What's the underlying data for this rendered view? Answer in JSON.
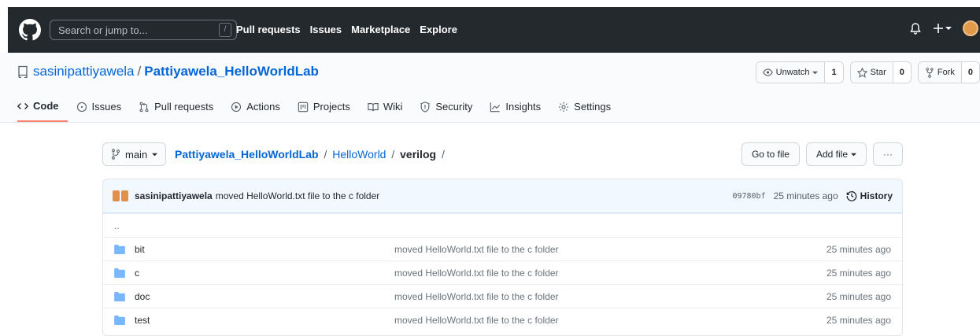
{
  "header": {
    "search_placeholder": "Search or jump to...",
    "search_key": "/",
    "nav": [
      "Pull requests",
      "Issues",
      "Marketplace",
      "Explore"
    ]
  },
  "repo": {
    "owner": "sasinipattiyawela",
    "separator": "/",
    "name": "Pattiyawela_HelloWorldLab",
    "watch_label": "Unwatch",
    "watch_count": "1",
    "star_label": "Star",
    "star_count": "0",
    "fork_label": "Fork",
    "fork_count": "0"
  },
  "tabs": [
    {
      "label": "Code",
      "icon": "code-icon",
      "selected": true
    },
    {
      "label": "Issues",
      "icon": "issue-icon"
    },
    {
      "label": "Pull requests",
      "icon": "pull-request-icon"
    },
    {
      "label": "Actions",
      "icon": "play-icon"
    },
    {
      "label": "Projects",
      "icon": "project-icon"
    },
    {
      "label": "Wiki",
      "icon": "book-icon"
    },
    {
      "label": "Security",
      "icon": "shield-icon"
    },
    {
      "label": "Insights",
      "icon": "graph-icon"
    },
    {
      "label": "Settings",
      "icon": "gear-icon"
    }
  ],
  "file_nav": {
    "branch": "main",
    "crumb_root": "Pattiyawela_HelloWorldLab",
    "crumb_mid": "HelloWorld",
    "crumb_current": "verilog",
    "sep": "/",
    "goto_label": "Go to file",
    "add_label": "Add file",
    "more_label": "···"
  },
  "commit": {
    "author": "sasinipattiyawela",
    "message": "moved HelloWorld.txt file to the c folder",
    "sha": "09780bf",
    "age": "25 minutes ago",
    "history_label": "History"
  },
  "files": {
    "up": "..",
    "rows": [
      {
        "name": "bit",
        "message": "moved HelloWorld.txt file to the c folder",
        "age": "25 minutes ago"
      },
      {
        "name": "c",
        "message": "moved HelloWorld.txt file to the c folder",
        "age": "25 minutes ago"
      },
      {
        "name": "doc",
        "message": "moved HelloWorld.txt file to the c folder",
        "age": "25 minutes ago"
      },
      {
        "name": "test",
        "message": "moved HelloWorld.txt file to the c folder",
        "age": "25 minutes ago"
      }
    ]
  },
  "colors": {
    "header_bg": "#24292e",
    "link": "#0366d6",
    "folder": "#79b8ff",
    "tab_underline": "#f9826c",
    "commit_bar_bg": "#f1f8ff"
  }
}
